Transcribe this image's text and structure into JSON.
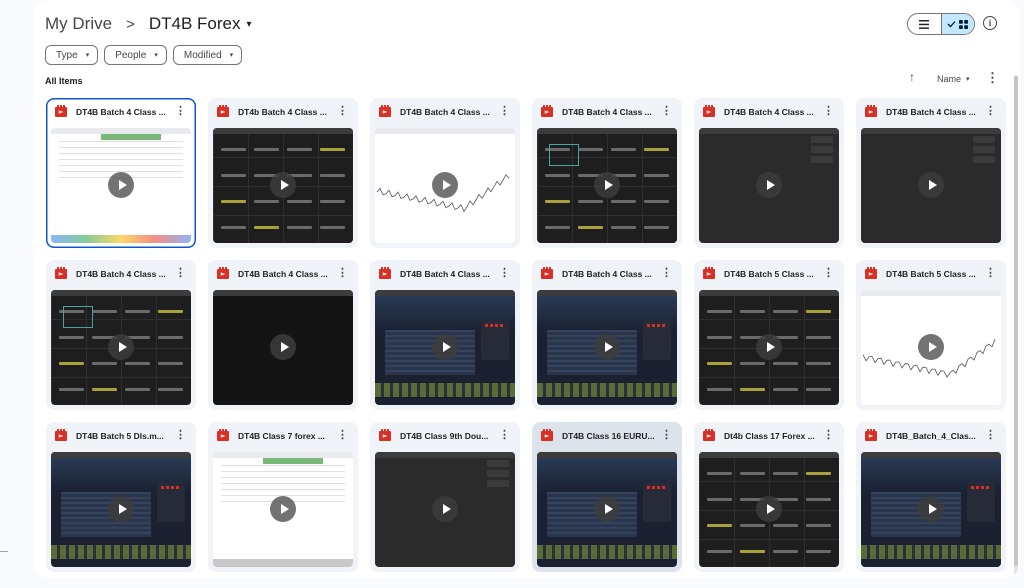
{
  "breadcrumb": {
    "root": "My Drive",
    "separator": ">",
    "current": "DT4B Forex",
    "current_caret": "▾"
  },
  "view_toggle": {
    "list_icon": "list-icon",
    "grid_icon": "grid-icon",
    "active": "grid"
  },
  "info_icon": "info-icon",
  "filters": [
    {
      "label": "Type",
      "caret": "▾"
    },
    {
      "label": "People",
      "caret": "▾"
    },
    {
      "label": "Modified",
      "caret": "▾"
    }
  ],
  "section_label": "All Items",
  "sort": {
    "arrow": "↑",
    "label": "Name",
    "caret": "▾",
    "more": "⋮"
  },
  "colors": {
    "accent": "#0b57d0",
    "video_icon": "#d93025",
    "toggle_active": "#c2e7ff",
    "card_bg": "#f0f4f9"
  },
  "files": [
    {
      "title": "DT4B Batch 4 Class ...",
      "thumb": "doc-white",
      "selected": true
    },
    {
      "title": "DT4b Batch 4 Class ...",
      "thumb": "grid-dark"
    },
    {
      "title": "DT4B Batch 4 Class ...",
      "thumb": "chart-white"
    },
    {
      "title": "DT4B Batch 4 Class ...",
      "thumb": "grid-dark-box"
    },
    {
      "title": "DT4B Batch 4 Class ...",
      "thumb": "blank-dark"
    },
    {
      "title": "DT4B Batch 4 Class ...",
      "thumb": "blank-dark"
    },
    {
      "title": "DT4B Batch 4 Class ...",
      "thumb": "grid-dark-box"
    },
    {
      "title": "DT4B Batch 4 Class ...",
      "thumb": "black"
    },
    {
      "title": "DT4B Batch 4 Class ...",
      "thumb": "app-screen"
    },
    {
      "title": "DT4B Batch 4 Class ...",
      "thumb": "app-screen"
    },
    {
      "title": "DT4B Batch 5 Class ...",
      "thumb": "grid-dark"
    },
    {
      "title": "DT4B Batch 5 Class ...",
      "thumb": "chart-white"
    },
    {
      "title": "DT4B Batch 5 Dls.m...",
      "thumb": "app-screen"
    },
    {
      "title": "DT4B Class 7 forex ...",
      "thumb": "doc-white"
    },
    {
      "title": "DT4B Class 9th Dou...",
      "thumb": "blank-dark"
    },
    {
      "title": "DT4B Class 16 EURU...",
      "thumb": "app-screen",
      "hovered": true
    },
    {
      "title": "Dt4b Class 17 Forex ...",
      "thumb": "grid-dark"
    },
    {
      "title": "DT4B_Batch_4_Clas...",
      "thumb": "app-screen"
    }
  ],
  "card_menu_icon": "⋮"
}
